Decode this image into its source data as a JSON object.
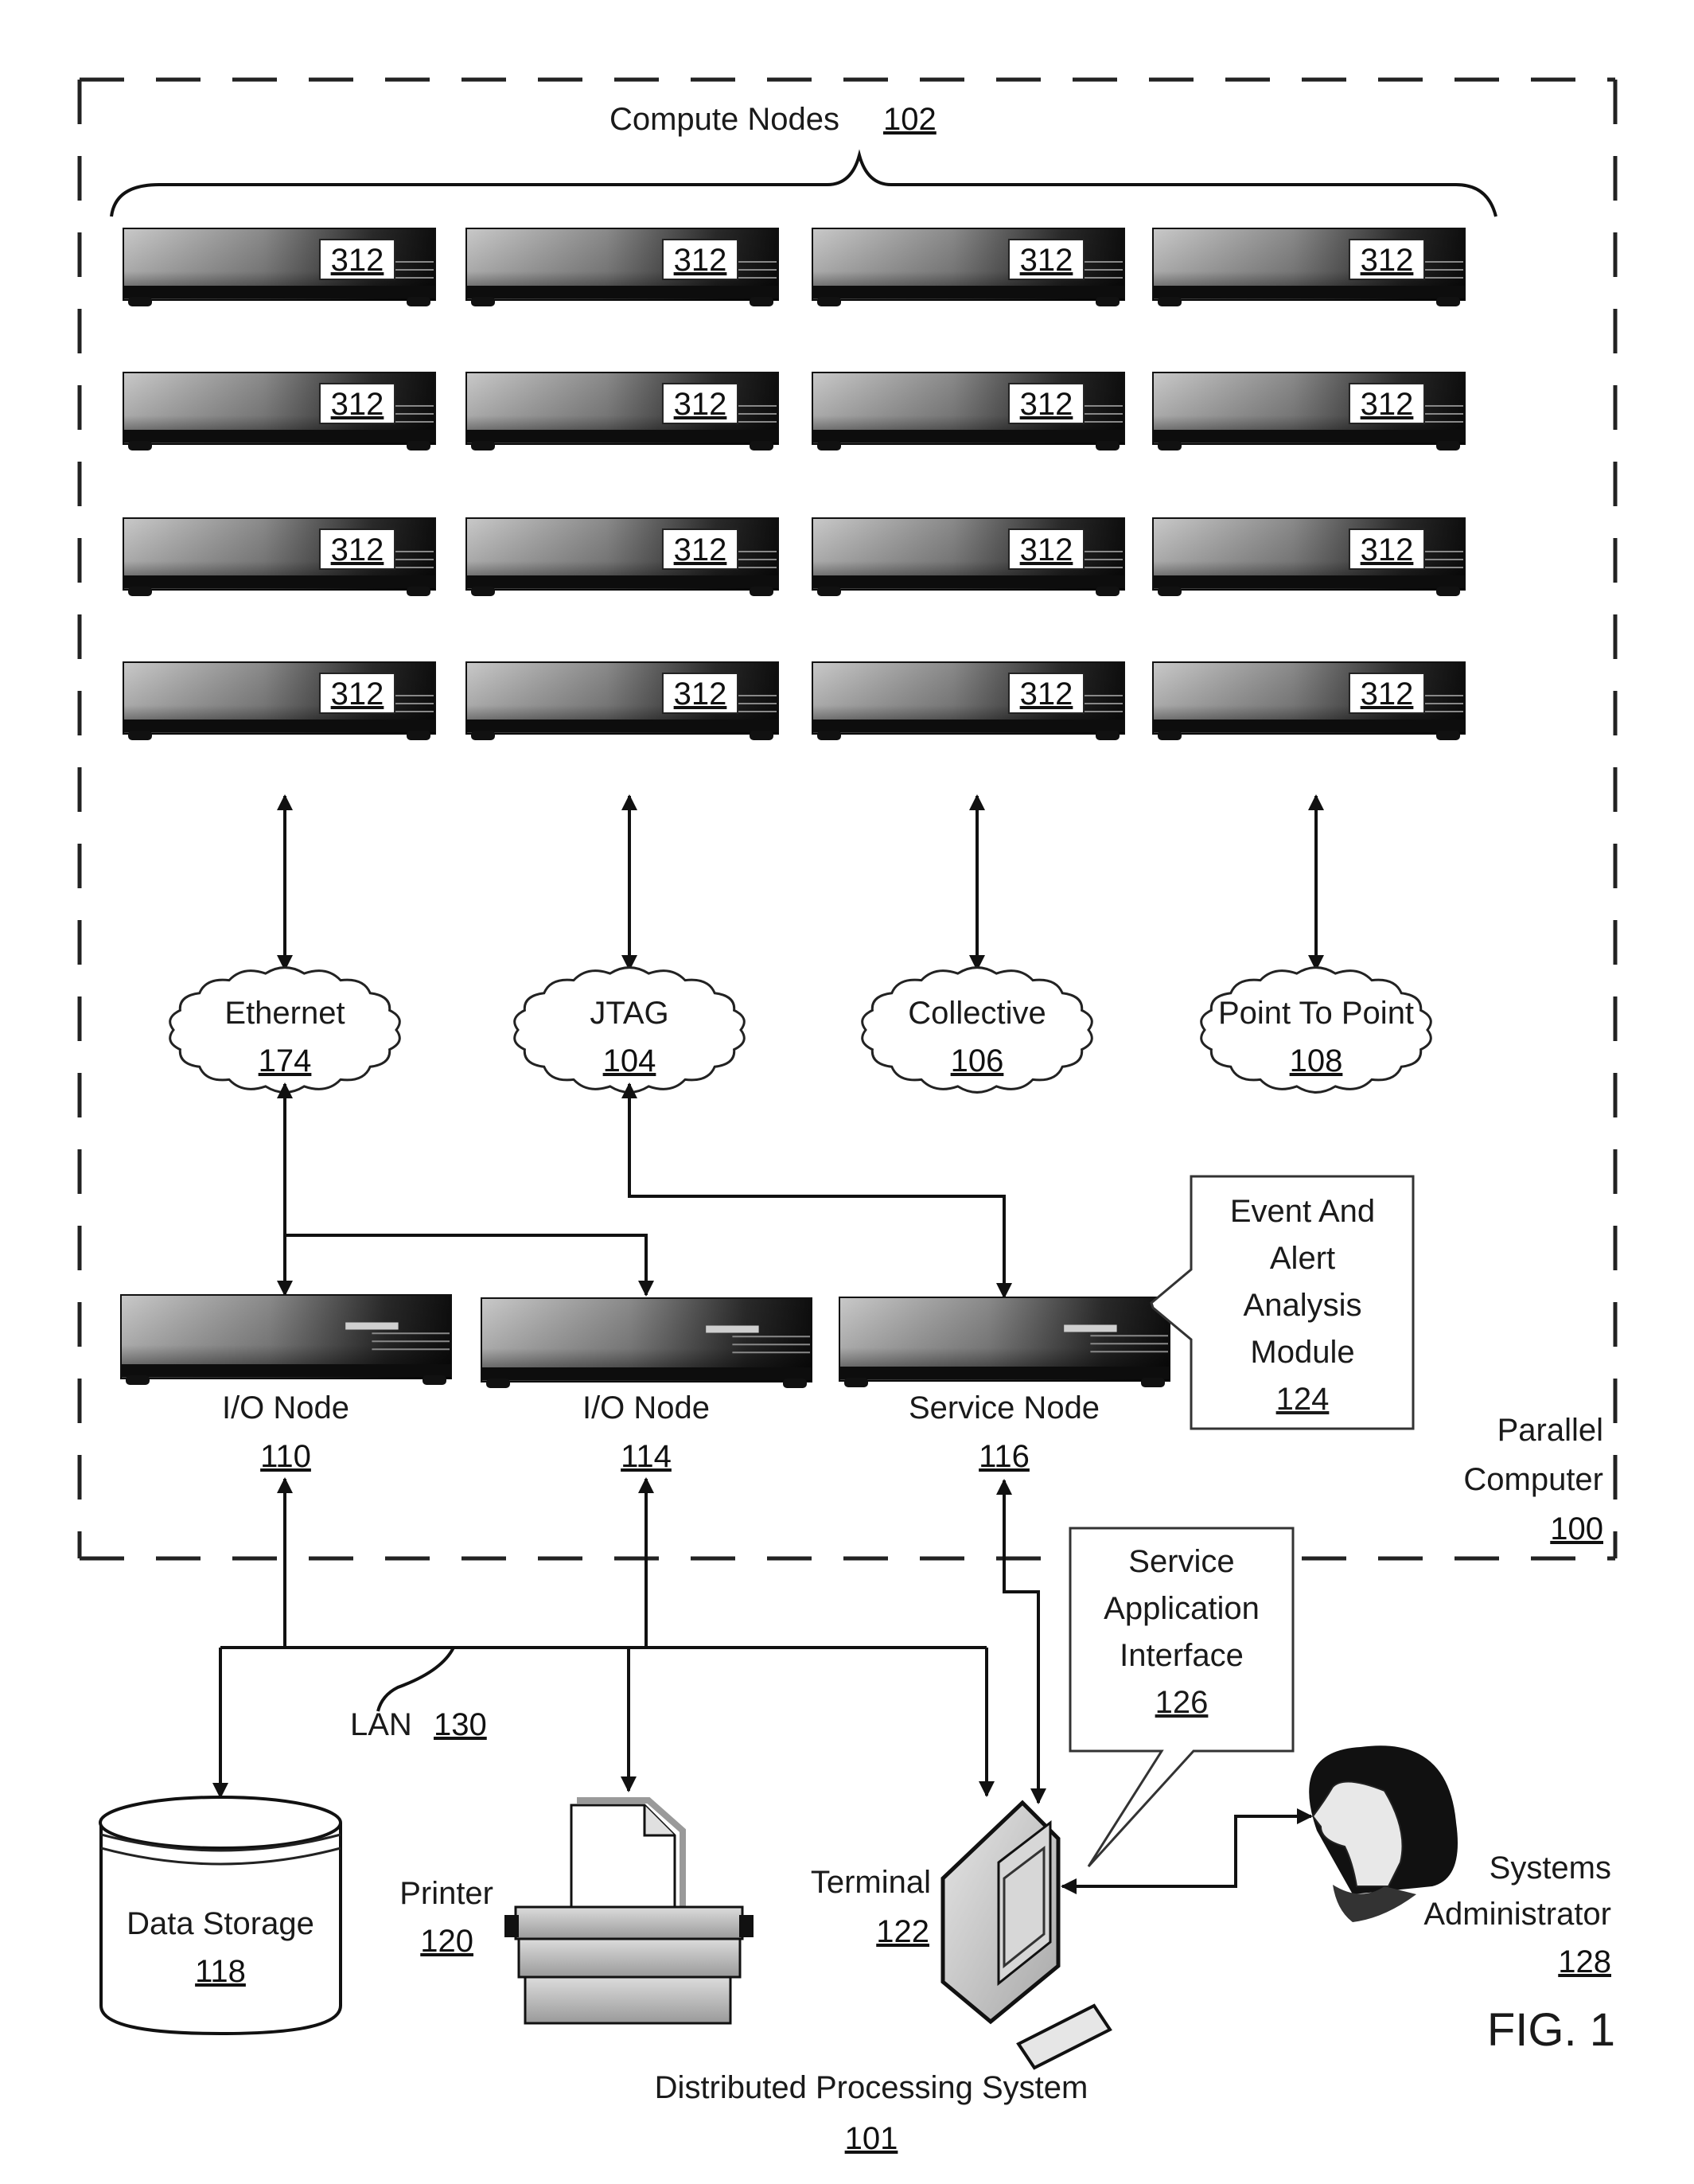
{
  "figure": {
    "label": "FIG. 1",
    "system_title": "Distributed Processing System",
    "system_ref": "101"
  },
  "parallel_computer": {
    "line1": "Parallel",
    "line2": "Computer",
    "ref": "100"
  },
  "compute_nodes": {
    "title": "Compute Nodes",
    "ref": "102",
    "rows": 4,
    "cols": 4,
    "node_ref": "312"
  },
  "networks": [
    {
      "name": "Ethernet",
      "ref": "174"
    },
    {
      "name": "JTAG",
      "ref": "104"
    },
    {
      "name": "Collective",
      "ref": "106"
    },
    {
      "name": "Point To Point",
      "ref": "108"
    }
  ],
  "nodes": [
    {
      "name": "I/O Node",
      "ref": "110"
    },
    {
      "name": "I/O Node",
      "ref": "114"
    },
    {
      "name": "Service Node",
      "ref": "116"
    }
  ],
  "event_module": {
    "lines": [
      "Event And",
      "Alert",
      "Analysis",
      "Module"
    ],
    "ref": "124"
  },
  "service_interface": {
    "lines": [
      "Service",
      "Application",
      "Interface"
    ],
    "ref": "126"
  },
  "lan": {
    "name": "LAN",
    "ref": "130"
  },
  "data_storage": {
    "name": "Data Storage",
    "ref": "118"
  },
  "printer": {
    "name": "Printer",
    "ref": "120"
  },
  "terminal": {
    "name": "Terminal",
    "ref": "122"
  },
  "admin": {
    "line1": "Systems",
    "line2": "Administrator",
    "ref": "128"
  },
  "colors": {
    "ink": "#111111",
    "node_dark": "#1a1a1a",
    "node_light": "#bdbdbd",
    "background": "#ffffff"
  }
}
